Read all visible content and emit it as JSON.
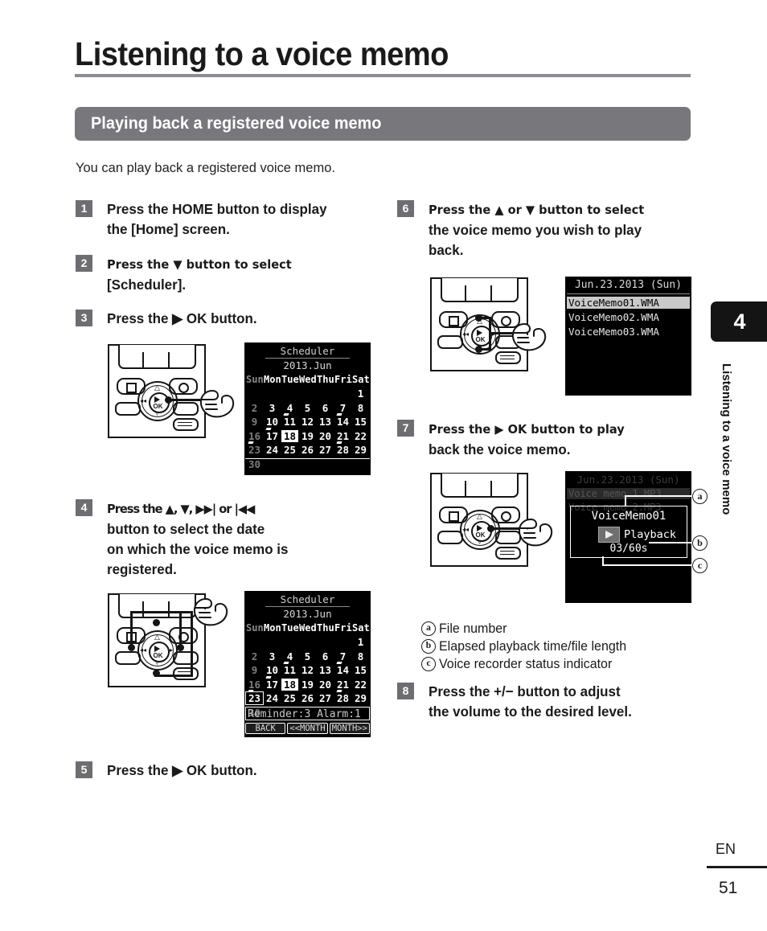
{
  "header": {
    "chapter_title": "Listening to a voice memo",
    "section_title": "Playing back a registered voice memo",
    "intro": "You can play back a registered voice memo."
  },
  "steps": {
    "s1": {
      "num": "1",
      "line1": "Press the HOME button to display",
      "line2": "the [Home] screen."
    },
    "s2": {
      "num": "2",
      "line1": "Press the ▼ button to select",
      "line2": "[Scheduler]."
    },
    "s3": {
      "num": "3",
      "line1": "Press the ▶ OK button."
    },
    "s4": {
      "num": "4",
      "line1": "Press the ▲, ▼, ▶▶| or |◀◀",
      "line2": "button to select the date",
      "line3": "on which the voice memo is",
      "line4": "registered."
    },
    "s5": {
      "num": "5",
      "line1": "Press the ▶ OK button."
    },
    "s6": {
      "num": "6",
      "line1": "Press the ▲ or ▼ button to select",
      "line2": "the voice memo you wish to play",
      "line3": "back."
    },
    "s7": {
      "num": "7",
      "line1": "Press the ▶ OK button to play",
      "line2": "back the voice memo."
    },
    "s8": {
      "num": "8",
      "line1": "Press the +/− button to adjust",
      "line2": "the volume to the desired level."
    }
  },
  "lcd_calendar_1": {
    "title": "Scheduler",
    "month": "2013.Jun",
    "weekdays": [
      "Sun",
      "Mon",
      "Tue",
      "Wed",
      "Thu",
      "Fri",
      "Sat"
    ],
    "rows": [
      [
        {
          "d": "",
          "s": "blank"
        },
        {
          "d": "",
          "s": "blank"
        },
        {
          "d": "",
          "s": "blank"
        },
        {
          "d": "",
          "s": "blank"
        },
        {
          "d": "",
          "s": "blank"
        },
        {
          "d": "",
          "s": "blank"
        },
        {
          "d": "1",
          "s": "normal"
        }
      ],
      [
        {
          "d": "2",
          "s": "dim"
        },
        {
          "d": "3",
          "s": "normal"
        },
        {
          "d": "4",
          "s": "normal"
        },
        {
          "d": "5",
          "s": "normal"
        },
        {
          "d": "6",
          "s": "normal"
        },
        {
          "d": "7",
          "s": "normal"
        },
        {
          "d": "8",
          "s": "normal"
        }
      ],
      [
        {
          "d": "9",
          "s": "dim"
        },
        {
          "d": "10",
          "s": "normal"
        },
        {
          "d": "11",
          "s": "mark"
        },
        {
          "d": "12",
          "s": "normal"
        },
        {
          "d": "13",
          "s": "normal"
        },
        {
          "d": "14",
          "s": "mark"
        },
        {
          "d": "15",
          "s": "normal"
        }
      ],
      [
        {
          "d": "16",
          "s": "dim"
        },
        {
          "d": "17",
          "s": "mark"
        },
        {
          "d": "18",
          "s": "selected"
        },
        {
          "d": "19",
          "s": "normal"
        },
        {
          "d": "20",
          "s": "normal"
        },
        {
          "d": "21",
          "s": "normal"
        },
        {
          "d": "22",
          "s": "normal"
        }
      ],
      [
        {
          "d": "23",
          "s": "dimmark"
        },
        {
          "d": "24",
          "s": "normal"
        },
        {
          "d": "25",
          "s": "normal"
        },
        {
          "d": "26",
          "s": "normal"
        },
        {
          "d": "27",
          "s": "normal"
        },
        {
          "d": "28",
          "s": "mark"
        },
        {
          "d": "29",
          "s": "normal"
        }
      ],
      [
        {
          "d": "30",
          "s": "dim"
        },
        {
          "d": "",
          "s": "blank"
        },
        {
          "d": "",
          "s": "blank"
        },
        {
          "d": "",
          "s": "blank"
        },
        {
          "d": "",
          "s": "blank"
        },
        {
          "d": "",
          "s": "blank"
        },
        {
          "d": "",
          "s": "blank"
        }
      ]
    ]
  },
  "lcd_calendar_2": {
    "title": "Scheduler",
    "month": "2013.Jun",
    "weekdays": [
      "Sun",
      "Mon",
      "Tue",
      "Wed",
      "Thu",
      "Fri",
      "Sat"
    ],
    "rows": [
      [
        {
          "d": "",
          "s": "blank"
        },
        {
          "d": "",
          "s": "blank"
        },
        {
          "d": "",
          "s": "blank"
        },
        {
          "d": "",
          "s": "blank"
        },
        {
          "d": "",
          "s": "blank"
        },
        {
          "d": "",
          "s": "blank"
        },
        {
          "d": "1",
          "s": "normal"
        }
      ],
      [
        {
          "d": "2",
          "s": "dim"
        },
        {
          "d": "3",
          "s": "normal"
        },
        {
          "d": "4",
          "s": "normal"
        },
        {
          "d": "5",
          "s": "normal"
        },
        {
          "d": "6",
          "s": "normal"
        },
        {
          "d": "7",
          "s": "normal"
        },
        {
          "d": "8",
          "s": "normal"
        }
      ],
      [
        {
          "d": "9",
          "s": "dim"
        },
        {
          "d": "10",
          "s": "normal"
        },
        {
          "d": "11",
          "s": "mark"
        },
        {
          "d": "12",
          "s": "normal"
        },
        {
          "d": "13",
          "s": "normal"
        },
        {
          "d": "14",
          "s": "mark"
        },
        {
          "d": "15",
          "s": "normal"
        }
      ],
      [
        {
          "d": "16",
          "s": "dim"
        },
        {
          "d": "17",
          "s": "mark"
        },
        {
          "d": "18",
          "s": "selected"
        },
        {
          "d": "19",
          "s": "normal"
        },
        {
          "d": "20",
          "s": "normal"
        },
        {
          "d": "21",
          "s": "normal"
        },
        {
          "d": "22",
          "s": "normal"
        }
      ],
      [
        {
          "d": "23",
          "s": "cursor"
        },
        {
          "d": "24",
          "s": "normal"
        },
        {
          "d": "25",
          "s": "normal"
        },
        {
          "d": "26",
          "s": "normal"
        },
        {
          "d": "27",
          "s": "normal"
        },
        {
          "d": "28",
          "s": "mark"
        },
        {
          "d": "29",
          "s": "normal"
        }
      ],
      [
        {
          "d": "30",
          "s": "dim"
        },
        {
          "d": "",
          "s": "blank"
        },
        {
          "d": "",
          "s": "blank"
        },
        {
          "d": "",
          "s": "blank"
        },
        {
          "d": "",
          "s": "blank"
        },
        {
          "d": "",
          "s": "blank"
        },
        {
          "d": "",
          "s": "blank"
        }
      ]
    ],
    "info": "Reminder:3 Alarm:1",
    "buttons": [
      "BACK",
      "<<MONTH",
      "MONTH>>"
    ]
  },
  "lcd_filelist": {
    "title": "Jun.23.2013 (Sun)",
    "items": [
      "VoiceMemo01.WMA",
      "VoiceMemo02.WMA",
      "VoiceMemo03.WMA"
    ],
    "selected_index": 0
  },
  "lcd_playback": {
    "bg_title": "Jun.23.2013 (Sun)",
    "bg_row1": "Voice memo 1.MP3",
    "bg_row2": "Voice memo 2.MP3",
    "file_name": "VoiceMemo01",
    "status": "Playback",
    "time": "03/60s",
    "callout_a": "a",
    "callout_b": "b",
    "callout_c": "c"
  },
  "legend": [
    {
      "letter": "a",
      "text": "File number"
    },
    {
      "letter": "b",
      "text": "Elapsed playback time/file length"
    },
    {
      "letter": "c",
      "text": "Voice recorder status indicator"
    }
  ],
  "sidebar": {
    "chapter_number": "4",
    "chapter_label": "Listening to a voice memo"
  },
  "footer": {
    "language": "EN",
    "page_number": "51"
  },
  "device": {
    "ok_label": "OK"
  }
}
